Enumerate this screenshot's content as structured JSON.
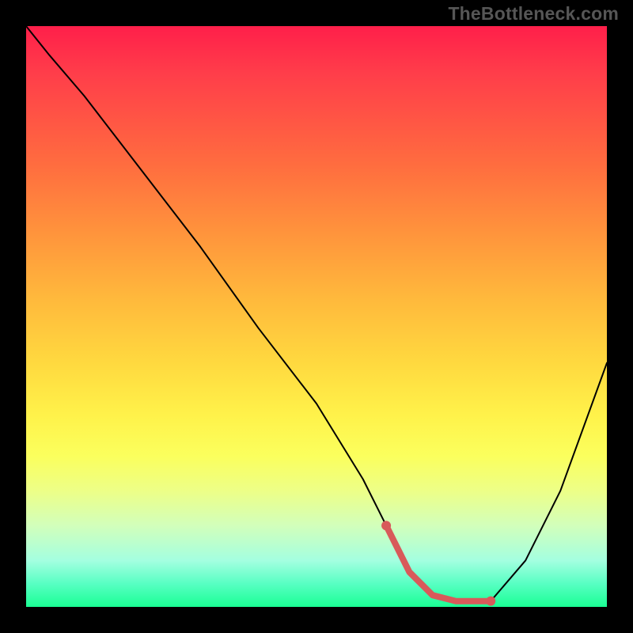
{
  "watermark": "TheBottleneck.com",
  "chart_data": {
    "type": "line",
    "title": "",
    "xlabel": "",
    "ylabel": "",
    "xlim": [
      0,
      100
    ],
    "ylim": [
      0,
      100
    ],
    "grid": false,
    "series": [
      {
        "name": "bottleneck-curve",
        "x": [
          0,
          4,
          10,
          20,
          30,
          40,
          50,
          58,
          62,
          66,
          70,
          74,
          78,
          80,
          86,
          92,
          100
        ],
        "y": [
          100,
          95,
          88,
          75,
          62,
          48,
          35,
          22,
          14,
          6,
          2,
          1,
          1,
          1,
          8,
          20,
          42
        ]
      }
    ],
    "accent_segment": {
      "name": "optimal-range",
      "x": [
        62,
        66,
        70,
        74,
        78,
        80
      ],
      "y": [
        14,
        6,
        2,
        1,
        1,
        1
      ],
      "endpoints": [
        {
          "x": 62,
          "y": 14
        },
        {
          "x": 80,
          "y": 1
        }
      ]
    },
    "gradient_colors": {
      "top": "#ff1f4a",
      "mid": "#ffe84a",
      "bottom": "#1aff94"
    }
  }
}
